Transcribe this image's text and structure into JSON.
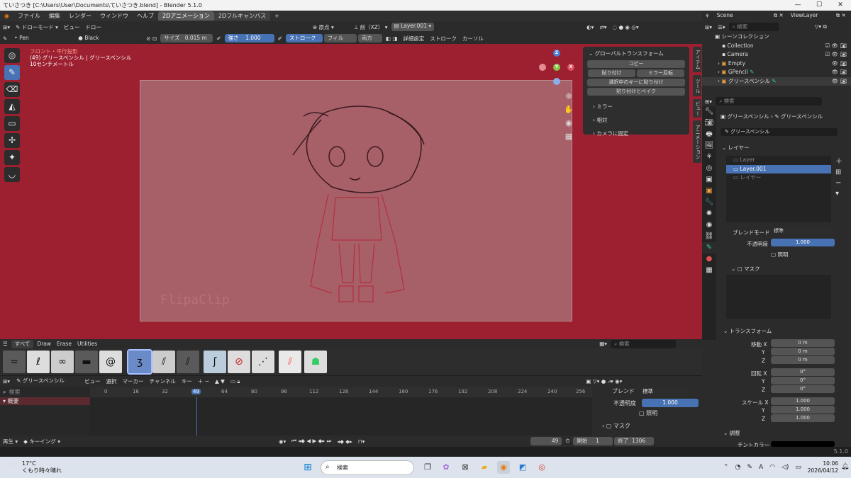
{
  "window": {
    "title": "ていさつき [C:\\Users\\User\\Documents\\ていさつき.blend] - Blender 5.1.0",
    "minimize": "—",
    "maximize": "☐",
    "close": "✕"
  },
  "menu": {
    "items": [
      "ファイル",
      "編集",
      "レンダー",
      "ウィンドウ",
      "ヘルプ"
    ],
    "workspaces": [
      "2Dアニメーション",
      "2Dフルキャンバス"
    ],
    "add_tab": "+"
  },
  "viewport_header": {
    "mode": "ドローモード",
    "view": "ビュー",
    "draw": "ドロー",
    "origin": "原点",
    "view_axis": "前（XZ）",
    "layer": "Layer.001"
  },
  "tool_header": {
    "brush": "• Pen",
    "material": "Black",
    "size_label": "サイズ",
    "size_value": "0.015 m",
    "strength_label": "強さ",
    "strength_value": "1.000",
    "stroke_tab": "ストローク",
    "fill_tab": "フィル",
    "both_tab": "両方",
    "advanced": "詳細設定",
    "stroke_menu": "ストローク",
    "cursor_menu": "カーソル"
  },
  "viewport": {
    "info_line1": "フロント・平行投影",
    "info_line2": "(49) グリースペンシル | グリースペンシル",
    "info_line3": "10センチメートル",
    "watermark": "FlipaClip"
  },
  "gt_panel": {
    "title": "グローバルトランスフォーム",
    "copy": "コピー",
    "paste": "貼り付け",
    "mirror_flip": "ミラー反転",
    "paste_selected": "選択中のキーに貼り付け",
    "paste_bake": "貼り付けとベイク",
    "mirror": "ミラー",
    "relative": "相対",
    "fix_camera": "カメラに固定"
  },
  "side_tabs": [
    "アイテム",
    "ツール",
    "ビュー",
    "アニメーション"
  ],
  "brush_bar": {
    "tabs": [
      "すべて",
      "Draw",
      "Erase",
      "Utilities"
    ],
    "search_placeholder": "検索"
  },
  "timeline": {
    "editor": "グリースペンシル",
    "menus": [
      "ビュー",
      "選択",
      "マーカー",
      "チャンネル",
      "キー"
    ],
    "search_placeholder": "検索",
    "summary": "概要",
    "frame_numbers": [
      "0",
      "16",
      "32",
      "49",
      "64",
      "80",
      "96",
      "112",
      "128",
      "144",
      "160",
      "176",
      "192",
      "208",
      "224",
      "240",
      "256"
    ],
    "current_frame": "49",
    "blend_label": "ブレンド",
    "blend_value": "標準",
    "opacity_label": "不透明度",
    "opacity_value": "1.000",
    "lighting": "照明",
    "mask": "マスク",
    "playback": "再生",
    "keying": "キーイング",
    "frame_display": "49",
    "start_label": "開始",
    "start_value": "1",
    "end_label": "終了",
    "end_value": "1306"
  },
  "status": {
    "version": "5.1.0"
  },
  "outliner": {
    "scene": "Scene",
    "viewlayer": "ViewLayer",
    "search_placeholder": "検索",
    "items": [
      "シーンコレクション",
      "Collection",
      "Camera",
      "Empty",
      "GPencil",
      "グリースペンシル"
    ]
  },
  "properties": {
    "search_placeholder": "検索",
    "breadcrumb1": "グリースペンシル",
    "breadcrumb2": "グリースペンシル",
    "object_name": "グリースペンシル",
    "layers_section": "レイヤー",
    "layers": [
      "Layer",
      "Layer.001",
      "レイヤー"
    ],
    "blend_mode_label": "ブレンドモード",
    "blend_mode_value": "標準",
    "opacity_label": "不透明度",
    "opacity_value": "1.000",
    "lighting": "照明",
    "mask": "マスク",
    "transform_section": "トランスフォーム",
    "move_label": "移動 X",
    "rotate_label": "回転 X",
    "scale_label": "スケール X",
    "y": "Y",
    "z": "Z",
    "move": [
      "0 m",
      "0 m",
      "0 m"
    ],
    "rotate": [
      "0°",
      "0°",
      "0°"
    ],
    "scale": [
      "1.000",
      "1.000",
      "1.000"
    ],
    "adjust_section": "調整",
    "tint_color": "チントカラー"
  },
  "taskbar": {
    "temp": "17°C",
    "weather": "くもり時々晴れ",
    "search": "検索",
    "time": "10:06",
    "date": "2026/04/12"
  }
}
